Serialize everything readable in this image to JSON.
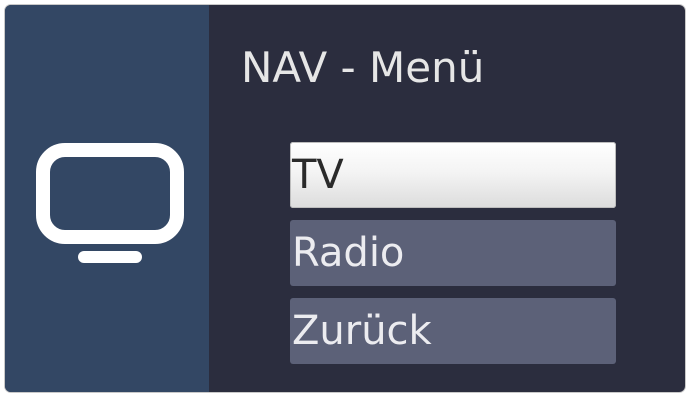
{
  "menu": {
    "title": "NAV - Menü",
    "items": [
      {
        "label": "TV",
        "selected": true
      },
      {
        "label": "Radio",
        "selected": false
      },
      {
        "label": "Zurück",
        "selected": false
      }
    ]
  },
  "icon": {
    "name": "tv-icon"
  },
  "colors": {
    "left_panel": "#334764",
    "background": "#2b2d3e",
    "item": "#5c6178",
    "selected_item": "#f4f4f4"
  }
}
